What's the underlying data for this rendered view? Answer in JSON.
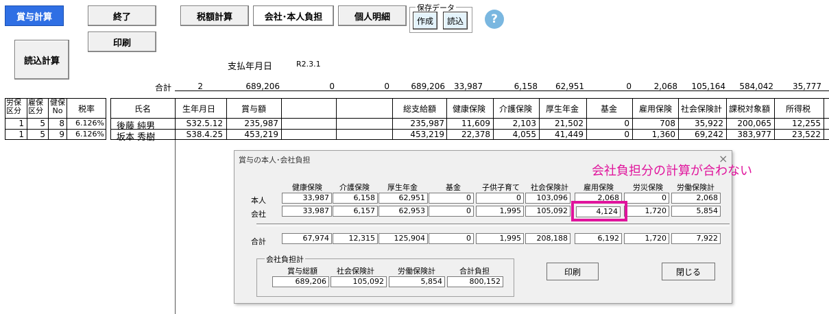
{
  "toolbar": {
    "bonus_calc": "賞与計算",
    "exit": "終了",
    "print": "印刷",
    "read_calc": "読込計算",
    "tax_calc": "税額計算",
    "company_personal": "会社･本人負担",
    "personal_detail": "個人明細",
    "save_data_label": "保存データ",
    "create": "作成",
    "load": "読込",
    "help": "?"
  },
  "pay_date": {
    "label": "支払年月日",
    "value": "R2.3.1"
  },
  "totals": {
    "label": "合計",
    "values": [
      "2",
      "689,206",
      "0",
      "0",
      "689,206",
      "33,987",
      "6,158",
      "62,951",
      "0",
      "2,068",
      "105,164",
      "584,042",
      "35,777"
    ]
  },
  "table": {
    "headers": {
      "rokyu": "労保\n区分",
      "koyo": "雇保\n区分",
      "kenpo": "健保\nNo",
      "rate": "税率",
      "name": "氏名",
      "birth": "生年月日",
      "bonus": "賞与額",
      "gross": "総支給額",
      "health": "健康保険",
      "care": "介護保険",
      "pension": "厚生年金",
      "fund": "基金",
      "employment": "雇用保険",
      "social_total": "社会保険計",
      "taxable": "課税対象額",
      "income_tax": "所得税"
    },
    "rows": [
      {
        "rokyu": "1",
        "koyo": "5",
        "kenpo": "8",
        "rate": "6.126%",
        "name": "後藤 純男",
        "birth": "S32.5.12",
        "bonus": "235,987",
        "gross": "235,987",
        "health": "11,609",
        "care": "2,103",
        "pension": "21,502",
        "fund": "0",
        "employment": "708",
        "social_total": "35,922",
        "taxable": "200,065",
        "income_tax": "12,255"
      },
      {
        "rokyu": "1",
        "koyo": "5",
        "kenpo": "9",
        "rate": "6.126%",
        "name": "坂本 秀樹",
        "birth": "S38.4.25",
        "bonus": "453,219",
        "gross": "453,219",
        "health": "22,378",
        "care": "4,055",
        "pension": "41,449",
        "fund": "0",
        "employment": "1,360",
        "social_total": "69,242",
        "taxable": "383,977",
        "income_tax": "23,522"
      }
    ]
  },
  "dialog": {
    "title": "賞与の本人･会社負担",
    "close": "×",
    "columns": [
      "健康保険",
      "介護保険",
      "厚生年金",
      "基金",
      "子供子育て",
      "社会保険計",
      "雇用保険",
      "労災保険",
      "労働保険計"
    ],
    "rows": [
      {
        "label": "本人",
        "values": [
          "33,987",
          "6,158",
          "62,951",
          "0",
          "0",
          "103,096",
          "2,068",
          "0",
          "2,068"
        ]
      },
      {
        "label": "会社",
        "values": [
          "33,987",
          "6,157",
          "62,953",
          "0",
          "1,995",
          "105,092",
          "4,124",
          "1,720",
          "5,854"
        ]
      },
      {
        "label": "合計",
        "values": [
          "67,974",
          "12,315",
          "125,904",
          "0",
          "1,995",
          "208,188",
          "6,192",
          "1,720",
          "7,922"
        ]
      }
    ],
    "company_total": {
      "label": "会社負担計",
      "columns": [
        "賞与総額",
        "社会保険計",
        "労働保険計",
        "合計負担"
      ],
      "values": [
        "689,206",
        "105,092",
        "5,854",
        "800,152"
      ]
    },
    "print": "印刷",
    "close_btn": "閉じる"
  },
  "annotation": {
    "text": "会社負担分の計算が合わない",
    "color": "#e0149c"
  }
}
